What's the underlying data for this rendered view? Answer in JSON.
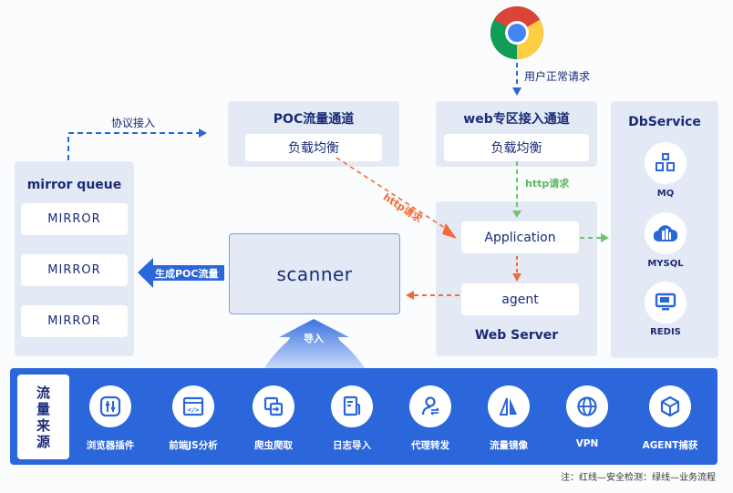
{
  "browser": {
    "icon": "chrome-icon",
    "request_label": "用户正常请求"
  },
  "protocol_link_label": "协议接入",
  "poc_channel": {
    "title": "POC流量通道",
    "inner": "负载均衡"
  },
  "web_channel": {
    "title": "web专区接入通道",
    "inner": "负载均衡"
  },
  "mirror_queue": {
    "title": "mirror queue",
    "items": [
      "MIRROR",
      "MIRROR",
      "MIRROR"
    ]
  },
  "scanner": {
    "label": "scanner",
    "generate_label": "生成POC流量",
    "import_label": "导入"
  },
  "web_server": {
    "title": "Web Server",
    "application": "Application",
    "agent": "agent"
  },
  "http_red_label": "http请求",
  "http_green_label": "http请求",
  "db_service": {
    "title": "DbService",
    "items": [
      {
        "label": "MQ",
        "icon": "cubes-icon"
      },
      {
        "label": "MYSQL",
        "icon": "cloud-database-icon"
      },
      {
        "label": "REDIS",
        "icon": "monitor-icon"
      }
    ]
  },
  "traffic_sources": {
    "title_chars": [
      "流",
      "量",
      "来",
      "源"
    ],
    "items": [
      {
        "label": "浏览器插件",
        "icon": "sliders-icon"
      },
      {
        "label": "前端JS分析",
        "icon": "code-window-icon"
      },
      {
        "label": "爬虫爬取",
        "icon": "crawl-transfer-icon"
      },
      {
        "label": "日志导入",
        "icon": "document-icon"
      },
      {
        "label": "代理转发",
        "icon": "user-forward-icon"
      },
      {
        "label": "流量镜像",
        "icon": "mirror-triangle-icon"
      },
      {
        "label": "VPN",
        "icon": "globe-icon"
      },
      {
        "label": "AGENT捕获",
        "icon": "cube-icon"
      }
    ]
  },
  "note": "注：红线—安全检测：绿线—业务流程",
  "colors": {
    "primary_blue": "#2b66db",
    "dark_navy": "#1a2a78",
    "panel_bg": "#e3eaf5",
    "red_line": "#f26a35",
    "green_line": "#6cc46b"
  }
}
